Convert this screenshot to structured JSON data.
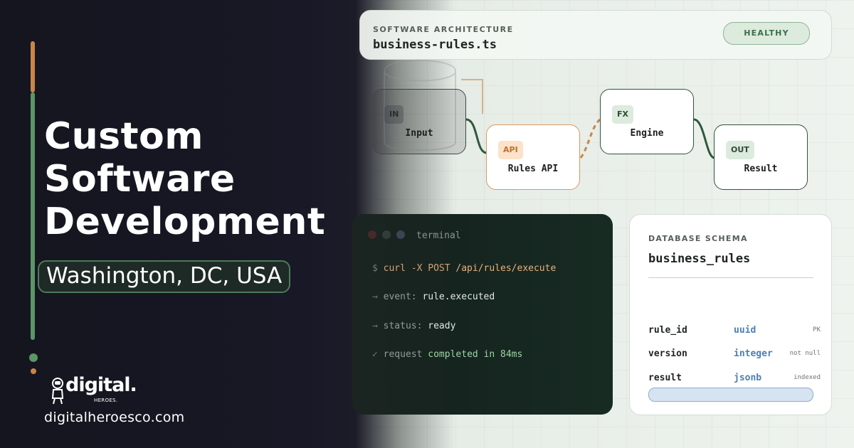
{
  "hero": {
    "title_lines": [
      "Custom",
      "Software",
      "Development"
    ],
    "location": "Washington, DC, USA",
    "logo_text": "digital.",
    "logo_sub": "HEROES.",
    "website": "digitalheroesco.com"
  },
  "header": {
    "label": "SOFTWARE ARCHITECTURE",
    "file": "business-rules.ts",
    "status": "HEALTHY"
  },
  "nodes": [
    {
      "tag": "IN",
      "label": "Input"
    },
    {
      "tag": "API",
      "label": "Rules API"
    },
    {
      "tag": "FX",
      "label": "Engine"
    },
    {
      "tag": "OUT",
      "label": "Result"
    }
  ],
  "terminal": {
    "title": "terminal",
    "lines": [
      {
        "prefix": "$",
        "text_a": "curl -X POST ",
        "text_b": "/api/rules/execute"
      },
      {
        "prefix": "→",
        "text_a": "event: ",
        "text_b": "rule.executed"
      },
      {
        "prefix": "→",
        "text_a": "status: ",
        "text_b": "ready"
      },
      {
        "prefix": "✓",
        "text_a": "request ",
        "text_b": "completed in 84ms"
      }
    ]
  },
  "schema": {
    "label": "DATABASE SCHEMA",
    "name": "business_rules",
    "rows": [
      {
        "col": "rule_id",
        "type": "uuid",
        "flag": "PK"
      },
      {
        "col": "version",
        "type": "integer",
        "flag": "not null"
      },
      {
        "col": "result",
        "type": "jsonb",
        "flag": "indexed"
      }
    ]
  },
  "colors": {
    "accent_orange": "#c98548",
    "accent_green": "#5c9566",
    "status_green": "#3d6f48",
    "type_blue": "#4c80b5"
  },
  "icons": [
    "astronaut-logo-icon",
    "window-dot-icon",
    "arrow-right-icon",
    "check-icon"
  ]
}
